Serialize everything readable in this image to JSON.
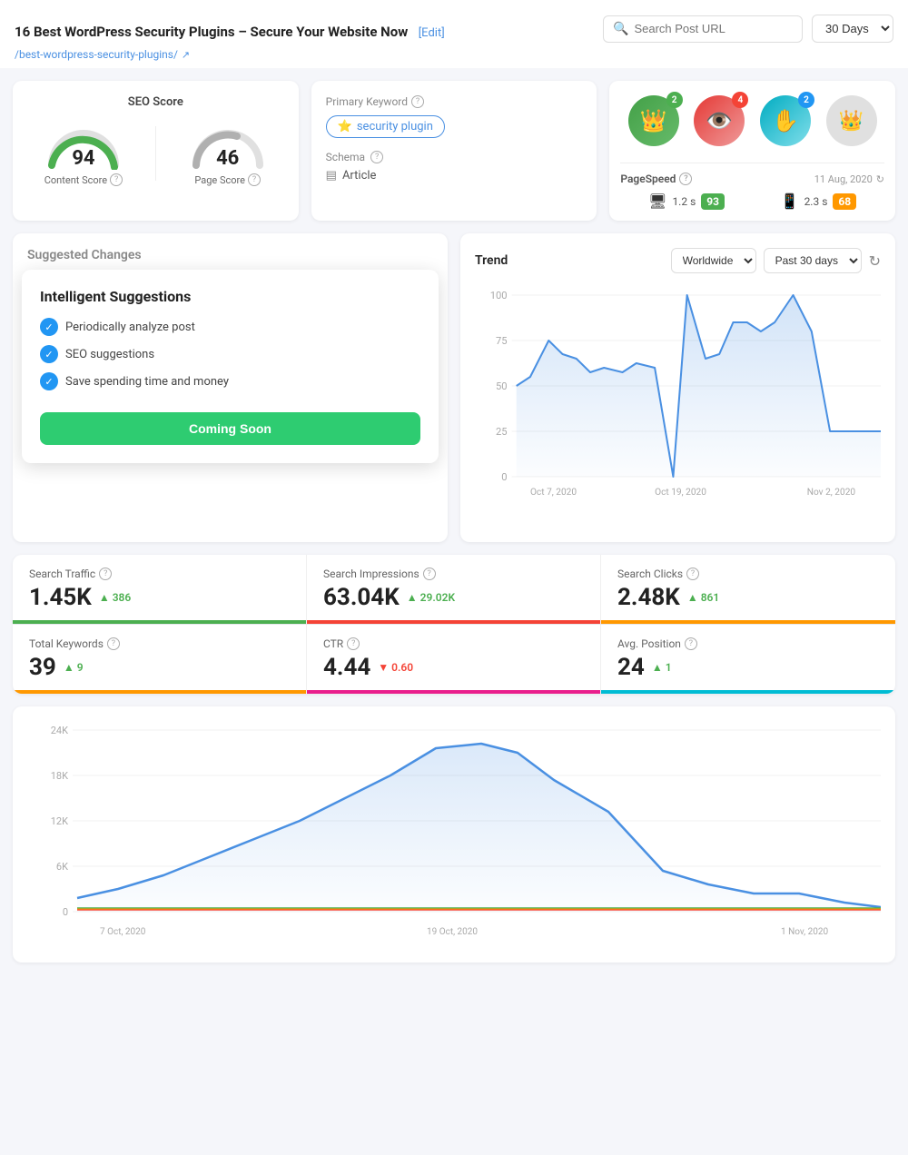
{
  "header": {
    "title": "16 Best WordPress Security Plugins – Secure Your Website Now",
    "edit_label": "[Edit]",
    "subtitle": "/best-wordpress-security-plugins/",
    "external_link": "↗",
    "search_placeholder": "Search Post URL",
    "date_range": "30 Days"
  },
  "seo_card": {
    "title": "SEO Score",
    "content_score": "94",
    "content_label": "Content Score",
    "page_score": "46",
    "page_label": "Page Score"
  },
  "keyword_card": {
    "primary_label": "Primary Keyword",
    "keyword": "security plugin",
    "schema_label": "Schema",
    "schema_value": "Article"
  },
  "icons": [
    {
      "emoji": "👑",
      "bg": "green-bg",
      "badge": "2",
      "badge_color": "green"
    },
    {
      "emoji": "👁",
      "bg": "red-bg",
      "badge": "4",
      "badge_color": "red"
    },
    {
      "emoji": "✋",
      "bg": "teal-bg",
      "badge": "2",
      "badge_color": "blue"
    },
    {
      "emoji": "👑",
      "bg": "gray-bg",
      "badge": null,
      "badge_color": null
    }
  ],
  "pagespeed": {
    "title": "PageSpeed",
    "date": "11 Aug, 2020",
    "desktop_time": "1.2 s",
    "desktop_score": "93",
    "mobile_time": "2.3 s",
    "mobile_score": "68"
  },
  "trend": {
    "title": "Trend",
    "location": "Worldwide",
    "period": "Past 30 days",
    "y_labels": [
      "100",
      "75",
      "50",
      "25",
      "0"
    ],
    "x_labels": [
      "Oct 7, 2020",
      "Oct 19, 2020",
      "Nov 2, 2020"
    ]
  },
  "suggested": {
    "title": "Suggested Changes",
    "overlay": {
      "title": "Intelligent Suggestions",
      "items": [
        "Periodically analyze post",
        "SEO suggestions",
        "Save spending time and money"
      ],
      "button": "Coming Soon"
    }
  },
  "stats": [
    {
      "label": "Search Traffic",
      "value": "1.45K",
      "change": "▲ 386",
      "change_dir": "up",
      "bar": "green"
    },
    {
      "label": "Search Impressions",
      "value": "63.04K",
      "change": "▲ 29.02K",
      "change_dir": "up",
      "bar": "red"
    },
    {
      "label": "Search Clicks",
      "value": "2.48K",
      "change": "▲ 861",
      "change_dir": "up",
      "bar": "orange"
    },
    {
      "label": "Total Keywords",
      "value": "39",
      "change": "▲ 9",
      "change_dir": "up",
      "bar": "orange"
    },
    {
      "label": "CTR",
      "value": "4.44",
      "change": "▼ 0.60",
      "change_dir": "down",
      "bar": "pink"
    },
    {
      "label": "Avg. Position",
      "value": "24",
      "change": "▲ 1",
      "change_dir": "up",
      "bar": "teal"
    }
  ],
  "bottom_chart": {
    "y_labels": [
      "24K",
      "18K",
      "12K",
      "6K",
      "0"
    ],
    "x_labels": [
      "7 Oct, 2020",
      "19 Oct, 2020",
      "1 Nov, 2020"
    ]
  }
}
